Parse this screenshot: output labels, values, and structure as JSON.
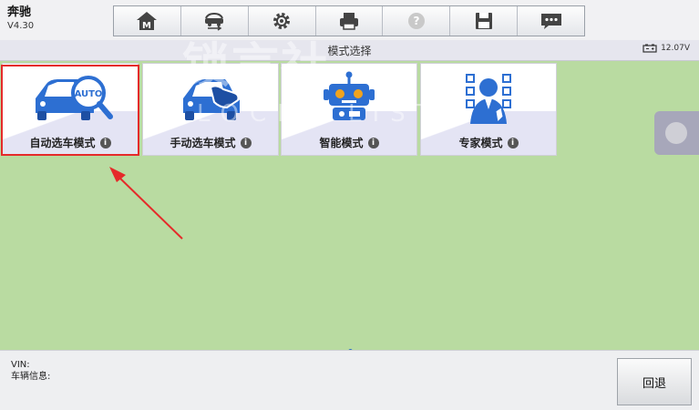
{
  "app": {
    "title": "奔驰",
    "version": "V4.30"
  },
  "toolbar": {
    "buttons": [
      {
        "name": "home-icon"
      },
      {
        "name": "car-swap-icon"
      },
      {
        "name": "gear-icon"
      },
      {
        "name": "printer-icon"
      },
      {
        "name": "help-icon"
      },
      {
        "name": "save-icon"
      },
      {
        "name": "message-icon"
      }
    ]
  },
  "header": {
    "title": "模式选择",
    "voltage": "12.07V",
    "battery_icon": "battery-icon"
  },
  "tiles": [
    {
      "label": "自动选车模式",
      "icon": "auto-search-car-icon",
      "badge_text": "AUTO",
      "selected": true
    },
    {
      "label": "手动选车模式",
      "icon": "manual-select-car-icon",
      "selected": false
    },
    {
      "label": "智能模式",
      "icon": "robot-icon",
      "selected": false
    },
    {
      "label": "专家模式",
      "icon": "expert-person-icon",
      "selected": false
    }
  ],
  "info_glyph": "i",
  "footer": {
    "vin_label": "VIN:",
    "vehicle_info_label": "车辆信息:",
    "back_label": "回退"
  },
  "watermark": {
    "text": "锁言社",
    "sub": "LOCKS LIST"
  },
  "colors": {
    "background": "#b9dba1",
    "accent": "#2d6fd2",
    "highlight": "#e52a2a"
  }
}
